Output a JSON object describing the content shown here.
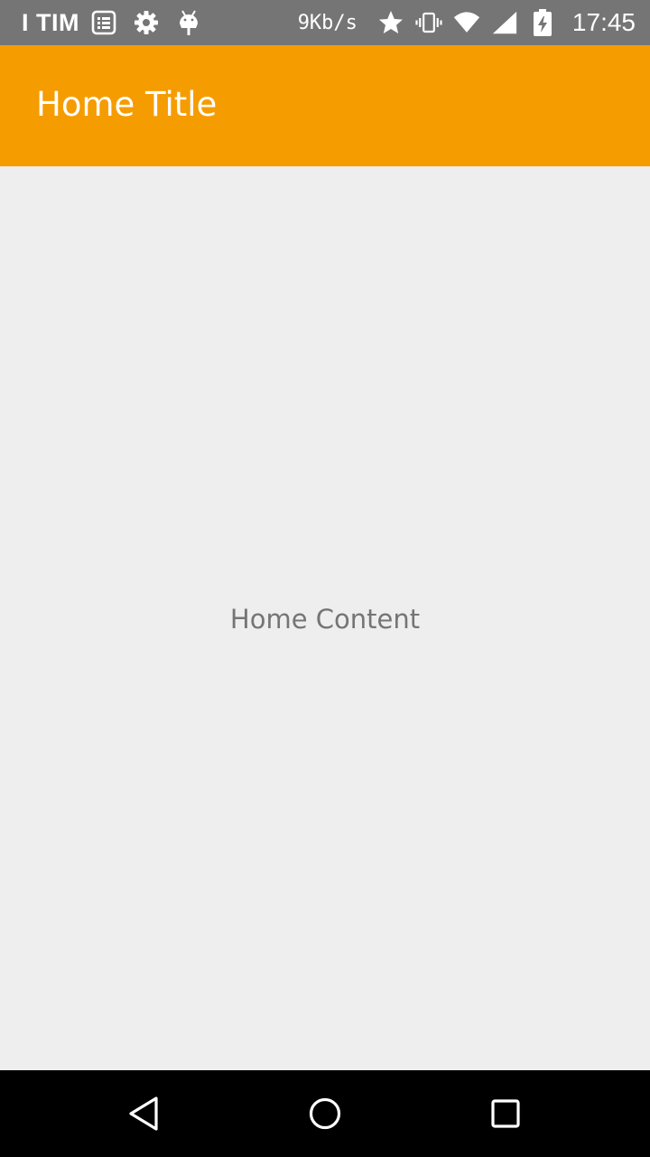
{
  "status_bar": {
    "carrier": "I TIM",
    "net_speed": "9Kb/s",
    "time": "17:45",
    "icons_left": [
      "notes-icon",
      "settings-gear-icon",
      "android-debug-icon"
    ],
    "icons_right": [
      "star-icon",
      "vibrate-icon",
      "wifi-icon",
      "cell-signal-icon",
      "battery-charging-icon"
    ]
  },
  "app_bar": {
    "title": "Home Title",
    "color": "#f59c00"
  },
  "content": {
    "text": "Home Content"
  },
  "nav_bar": {
    "buttons": [
      "back-icon",
      "home-icon",
      "recents-icon"
    ]
  }
}
